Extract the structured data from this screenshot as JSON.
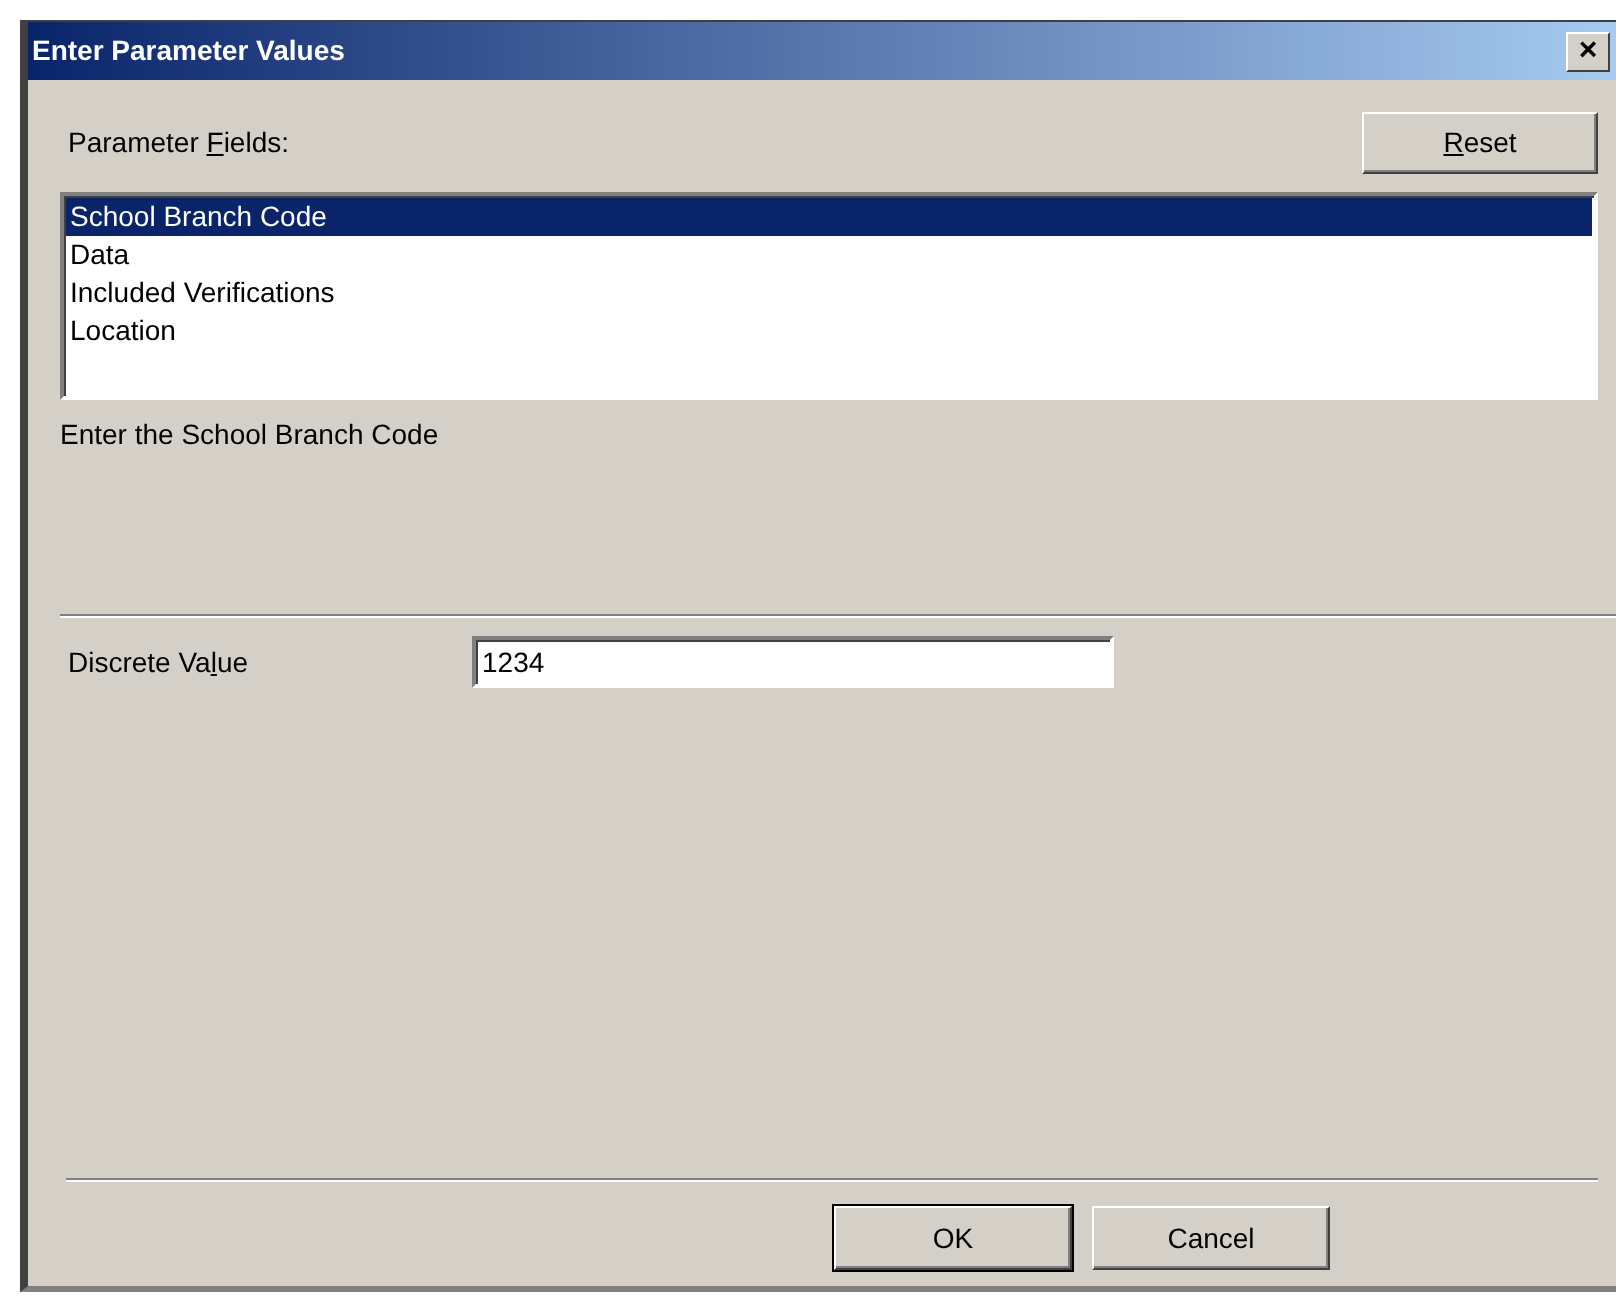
{
  "window": {
    "title": "Enter Parameter Values",
    "close": "×"
  },
  "parameter_fields_label": {
    "before": "Parameter ",
    "key": "F",
    "after": "ields:"
  },
  "reset_button": {
    "key": "R",
    "after": "eset"
  },
  "parameter_fields": [
    {
      "label": "School Branch Code",
      "selected": true
    },
    {
      "label": "Data",
      "selected": false
    },
    {
      "label": "Included Verifications",
      "selected": false
    },
    {
      "label": "Location",
      "selected": false
    }
  ],
  "description": "Enter the School Branch Code",
  "discrete_value": {
    "label": {
      "before": "Discrete Va",
      "key": "l",
      "after": "ue"
    },
    "value": "1234"
  },
  "buttons": [
    {
      "label": "OK",
      "default": true
    },
    {
      "label": "Cancel",
      "default": false
    }
  ]
}
